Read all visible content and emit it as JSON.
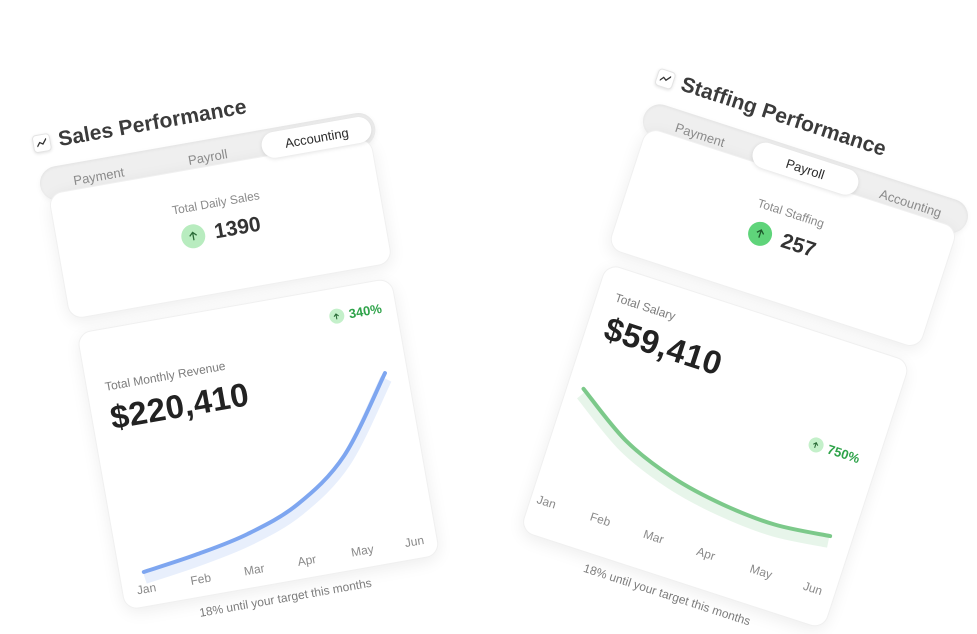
{
  "colors": {
    "sales_line": "#7ea6f0",
    "staffing_line": "#7cc98a",
    "up_green": "#2fa34a",
    "badge_bg": "#b8ecbf"
  },
  "sales": {
    "title": "Sales Performance",
    "icon": "chart-line-icon",
    "tabs": [
      "Payment",
      "Payroll",
      "Accounting"
    ],
    "active_tab": "Accounting",
    "summary": {
      "label": "Total Daily Sales",
      "value": "1390"
    },
    "metric": {
      "label": "Total Monthly Revenue",
      "value": "$220,410",
      "change": "340%"
    },
    "footnote": "18% until your target this months",
    "chart_data": {
      "type": "line",
      "categories": [
        "Jan",
        "Feb",
        "Mar",
        "Apr",
        "May",
        "Jun"
      ],
      "series": [
        {
          "values": [
            5,
            12,
            22,
            40,
            75,
            140
          ]
        }
      ]
    }
  },
  "staffing": {
    "title": "Staffing Performance",
    "icon": "chart-line-icon",
    "tabs": [
      "Payment",
      "Payroll",
      "Accounting"
    ],
    "active_tab": "Payroll",
    "summary": {
      "label": "Total Staffing",
      "value": "257"
    },
    "metric": {
      "label": "Total Salary",
      "value": "$59,410",
      "change": "750%"
    },
    "footnote": "18% until your target this months",
    "chart_data": {
      "type": "line",
      "categories": [
        "Jan",
        "Feb",
        "Mar",
        "Apr",
        "May",
        "Jun"
      ],
      "series": [
        {
          "values": [
            80,
            45,
            25,
            15,
            12,
            18
          ]
        }
      ]
    }
  }
}
